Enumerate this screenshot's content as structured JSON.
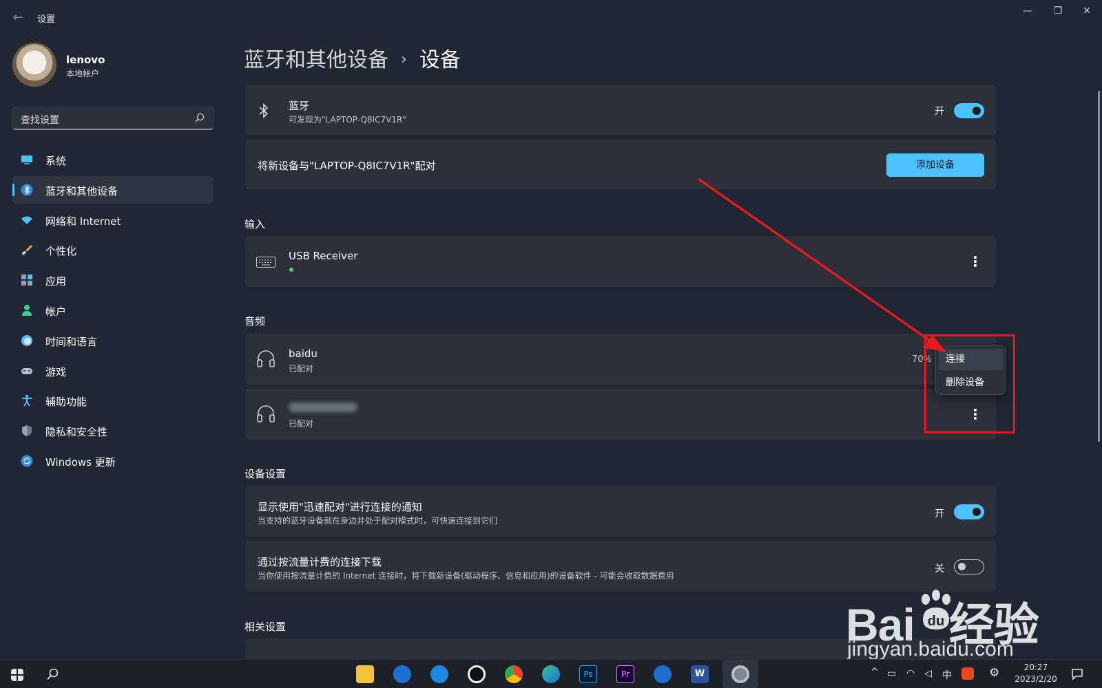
{
  "window": {
    "app_title": "设置",
    "minimize_icon": "minimize-icon",
    "restore_icon": "restore-icon",
    "close_icon": "close-icon"
  },
  "profile": {
    "name": "lenovo",
    "account_type": "本地帐户"
  },
  "search": {
    "placeholder": "查找设置"
  },
  "sidebar": {
    "items": [
      {
        "label": "系统",
        "icon": "system-icon"
      },
      {
        "label": "蓝牙和其他设备",
        "icon": "bluetooth-icon",
        "active": true
      },
      {
        "label": "网络和 Internet",
        "icon": "wifi-icon"
      },
      {
        "label": "个性化",
        "icon": "brush-icon"
      },
      {
        "label": "应用",
        "icon": "apps-icon"
      },
      {
        "label": "帐户",
        "icon": "account-icon"
      },
      {
        "label": "时间和语言",
        "icon": "time-language-icon"
      },
      {
        "label": "游戏",
        "icon": "gamepad-icon"
      },
      {
        "label": "辅助功能",
        "icon": "accessibility-icon"
      },
      {
        "label": "隐私和安全性",
        "icon": "shield-icon"
      },
      {
        "label": "Windows 更新",
        "icon": "update-icon"
      }
    ]
  },
  "breadcrumb": {
    "parent": "蓝牙和其他设备",
    "separator": "›",
    "current": "设备"
  },
  "bluetooth_card": {
    "title": "蓝牙",
    "subtitle": "可发现为\"LAPTOP-Q8IC7V1R\"",
    "toggle_label": "开",
    "toggle_on": true
  },
  "pair_card": {
    "text": "将新设备与\"LAPTOP-Q8IC7V1R\"配对",
    "button_label": "添加设备"
  },
  "input_section": {
    "heading": "输入",
    "devices": [
      {
        "name": "USB Receiver",
        "icon": "keyboard-icon",
        "status_color": "#6ccb5f"
      }
    ]
  },
  "audio_section": {
    "heading": "音频",
    "devices": [
      {
        "name": "baidu",
        "status": "已配对",
        "battery": "70%",
        "icon": "headphones-icon"
      },
      {
        "name": "",
        "status": "已配对",
        "icon": "headphones-icon"
      }
    ]
  },
  "context_menu": {
    "items": [
      "连接",
      "删除设备"
    ]
  },
  "device_settings": {
    "heading": "设备设置",
    "items": [
      {
        "title": "显示使用\"迅速配对\"进行连接的通知",
        "subtitle": "当支持的蓝牙设备就在身边并处于配对模式时，可快速连接到它们",
        "toggle_label": "开",
        "toggle_on": true
      },
      {
        "title": "通过按流量计费的连接下载",
        "subtitle": "当你使用按流量计费的 Internet 连接时，将下载新设备(驱动程序、信息和应用)的设备软件 - 可能会收取数据费用",
        "toggle_label": "关",
        "toggle_on": false
      }
    ]
  },
  "related_settings": {
    "heading": "相关设置"
  },
  "watermark": {
    "logo_text": "Bai du 经验",
    "url": "jingyan.baidu.com"
  },
  "taskbar": {
    "tray_ime": "中",
    "time": "20:27",
    "date": "2023/2/20"
  },
  "colors": {
    "accent": "#4cc2ff",
    "annotation_red": "#e8191b",
    "background": "#202633",
    "card": "#2b303b"
  }
}
